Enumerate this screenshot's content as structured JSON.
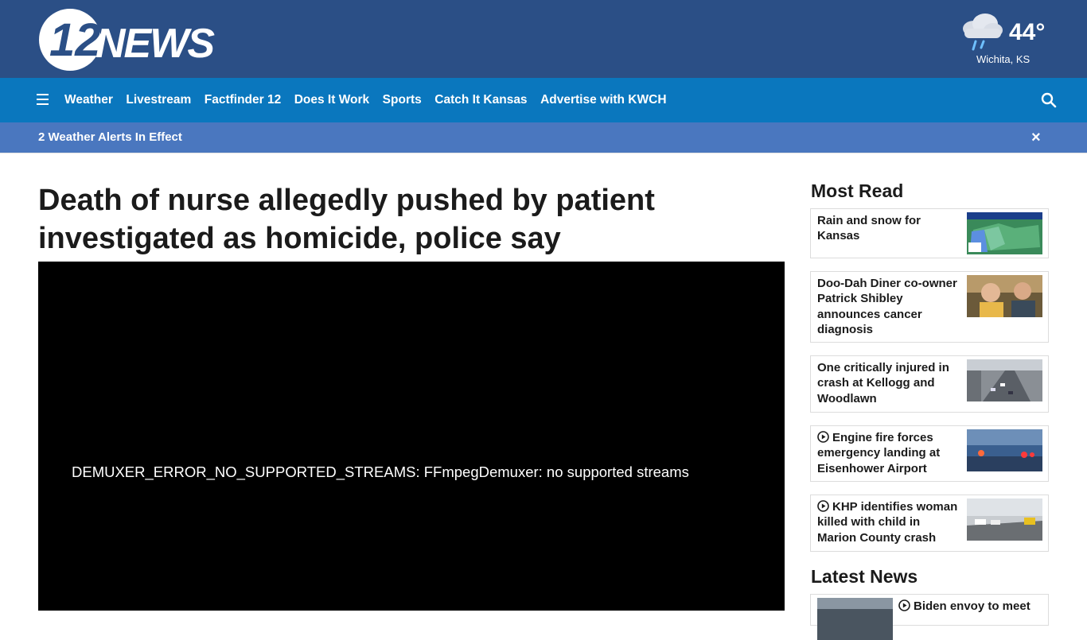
{
  "header": {
    "logo_text": "12NEWS",
    "weather": {
      "temp": "44°",
      "location": "Wichita, KS",
      "icon": "cloud-rain-icon"
    }
  },
  "nav": {
    "items": [
      {
        "label": "Weather"
      },
      {
        "label": "Livestream"
      },
      {
        "label": "Factfinder 12"
      },
      {
        "label": "Does It Work"
      },
      {
        "label": "Sports"
      },
      {
        "label": "Catch It Kansas"
      },
      {
        "label": "Advertise with KWCH"
      }
    ]
  },
  "alert": {
    "text": "2 Weather Alerts In Effect",
    "close": "×"
  },
  "article": {
    "headline": "Death of nurse allegedly pushed by patient investigated as homicide, police say",
    "video_error": "DEMUXER_ERROR_NO_SUPPORTED_STREAMS: FFmpegDemuxer: no supported streams"
  },
  "sidebar": {
    "most_read_title": "Most Read",
    "latest_title": "Latest News",
    "most_read": [
      {
        "title": "Rain and snow for Kansas",
        "video": false
      },
      {
        "title": "Doo-Dah Diner co-owner Patrick Shibley announces cancer diagnosis",
        "video": false
      },
      {
        "title": "One critically injured in crash at Kellogg and Woodlawn",
        "video": false
      },
      {
        "title": "Engine fire forces emergency landing at Eisenhower Airport",
        "video": true
      },
      {
        "title": "KHP identifies woman killed with child in Marion County crash",
        "video": true
      }
    ],
    "latest": [
      {
        "title": "Biden envoy to meet",
        "video": true
      }
    ]
  },
  "colors": {
    "header_bg": "#2b4f86",
    "nav_bg": "#0a77be",
    "alert_bg": "#4a77bf"
  }
}
